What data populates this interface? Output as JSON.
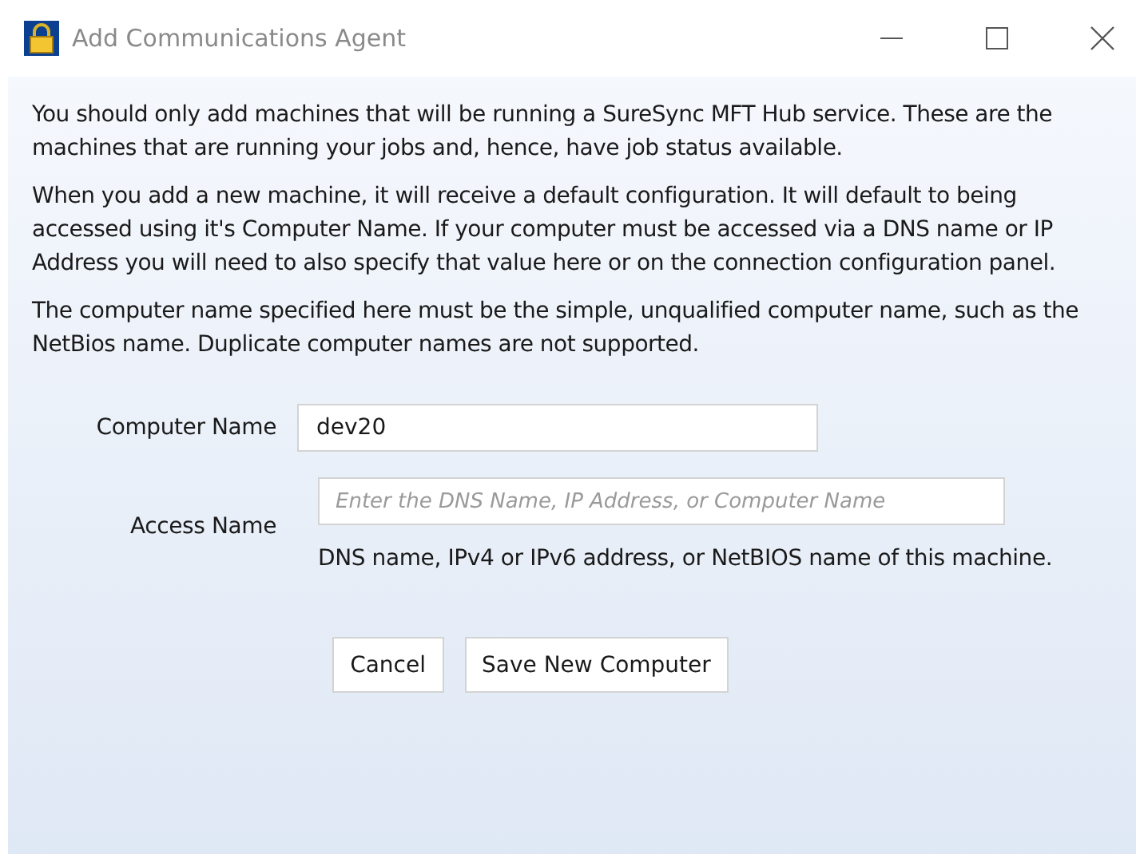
{
  "window": {
    "title": "Add Communications Agent"
  },
  "paragraphs": [
    "You should only add machines that will be running a SureSync MFT Hub service. These are the machines that are running your jobs and, hence, have job status available.",
    "When you add a new machine, it will receive a default configuration. It will default to being accessed using it's Computer Name. If your computer must be accessed via a DNS name or IP Address you will need to also specify that value here or on the connection configuration panel.",
    "The computer name specified here must be the simple, unqualified computer name, such as the NetBios name. Duplicate computer names are not supported."
  ],
  "computer_name": {
    "label": "Computer Name",
    "value": "dev20"
  },
  "access_name": {
    "label": "Access Name",
    "placeholder": "Enter the DNS Name, IP Address, or Computer Name",
    "help": "DNS name, IPv4 or IPv6 address, or NetBIOS name of this machine."
  },
  "buttons": [
    "Cancel",
    "Save New Computer"
  ]
}
